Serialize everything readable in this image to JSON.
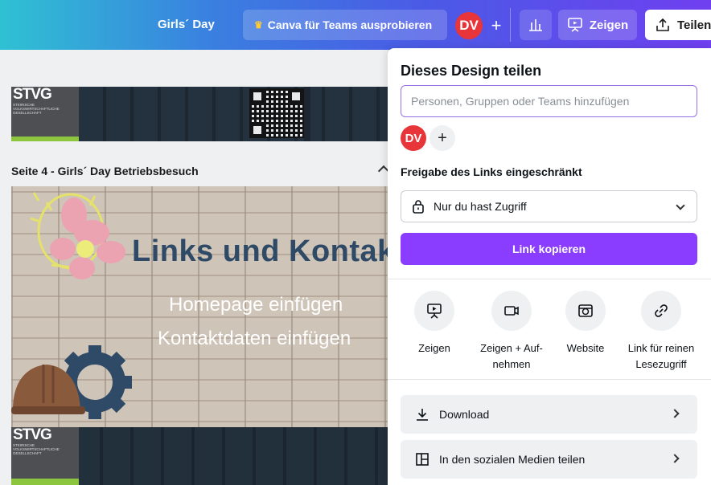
{
  "topbar": {
    "design_title": "Girls´ Day",
    "try_teams_label": "Canva für Teams ausprobieren",
    "avatar_initials": "DV",
    "add_label": "+",
    "present_label": "Zeigen",
    "share_label": "Teilen"
  },
  "canvas": {
    "slide3_logo": "STVG",
    "slide3_logo_sub": "STEIRISCHE VOLKSWIRTSCHAFTLICHE GESELLSCHAFT",
    "page4_label": "Seite 4 - Girls´ Day Betriebsbesuch",
    "slide4_title": "Links und Kontakt",
    "slide4_line1": "Homepage einfügen",
    "slide4_line2": "Kontaktdaten einfügen",
    "slide4_logo": "STVG",
    "slide4_logo_sub": "STEIRISCHE VOLKSWIRTSCHAFTLICHE GESELLSCHAFT"
  },
  "share_panel": {
    "title": "Dieses Design teilen",
    "input_placeholder": "Personen, Gruppen oder Teams hinzufügen",
    "member_initials": "DV",
    "add_member": "+",
    "access_label": "Freigabe des Links eingeschränkt",
    "access_value": "Nur du hast Zugriff",
    "copy_link_label": "Link kopieren",
    "options": [
      {
        "label": "Zeigen",
        "icon": "present-icon"
      },
      {
        "label": "Zeigen + Auf-nehmen",
        "icon": "record-icon"
      },
      {
        "label": "Website",
        "icon": "website-icon"
      },
      {
        "label": "Link für reinen Lesezugriff",
        "icon": "link-icon"
      }
    ],
    "download_label": "Download",
    "social_label": "In den sozialen Medien teilen"
  },
  "colors": {
    "accent": "#8b3dff",
    "avatar": "#e8353a",
    "logo_green": "#8cc63e",
    "slide_title": "#2e4a66"
  }
}
